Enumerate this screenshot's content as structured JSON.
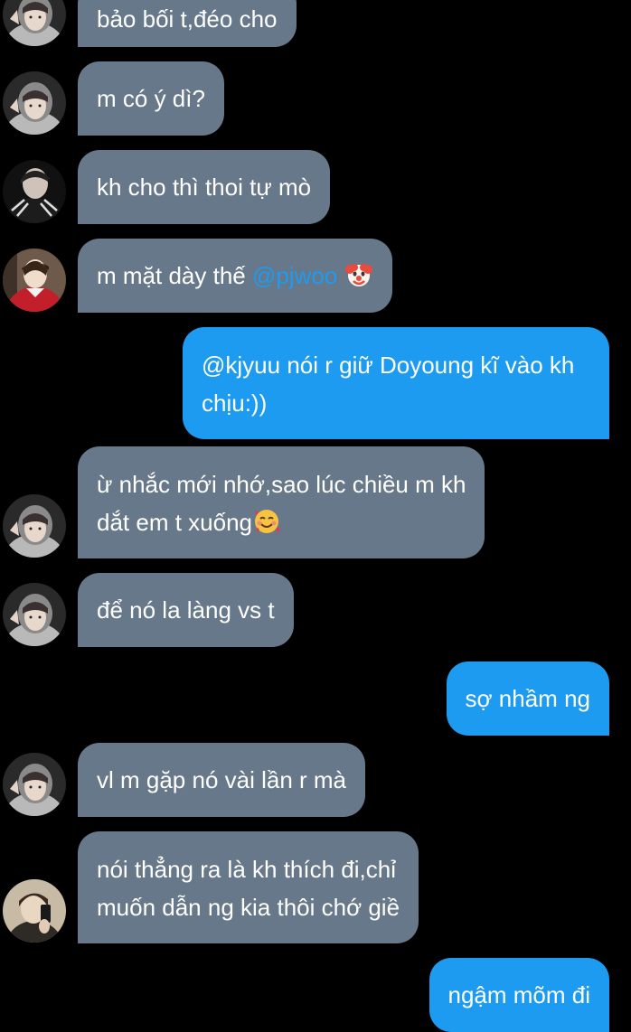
{
  "colors": {
    "background": "#000000",
    "incoming_bubble": "#67788a",
    "outgoing_bubble": "#1d9bf0",
    "mention": "#1d9bf0",
    "text": "#ffffff"
  },
  "messages": [
    {
      "direction": "incoming",
      "sender_avatar": "avatar-hood-boy-icon",
      "text": "bảo bối t,đéo cho"
    },
    {
      "direction": "incoming",
      "sender_avatar": "avatar-hood-boy-icon",
      "text": "m có ý dì?"
    },
    {
      "direction": "incoming",
      "sender_avatar": "avatar-dark-boy-icon",
      "text": "kh cho thì thoi tự mò"
    },
    {
      "direction": "incoming",
      "sender_avatar": "avatar-red-jacket-icon",
      "text_before": "m mặt dày thế ",
      "mention": "@pjwoo",
      "emoji": "clown-face-icon"
    },
    {
      "direction": "outgoing",
      "lines": [
        "@kjyuu nói r giữ Doyoung kĩ vào kh",
        "chịu:))"
      ]
    },
    {
      "direction": "incoming",
      "sender_avatar": "avatar-hood-boy-icon",
      "lines": [
        "ừ nhắc mới nhớ,sao lúc chiều m kh",
        "dắt em t xuống"
      ],
      "emoji": "smiling-face-with-hearts-icon"
    },
    {
      "direction": "incoming",
      "sender_avatar": "avatar-hood-boy-icon",
      "text": "để nó la làng vs t"
    },
    {
      "direction": "outgoing",
      "text": "sợ nhầm ng"
    },
    {
      "direction": "incoming",
      "sender_avatar": "avatar-hood-boy-icon",
      "text": "vl m gặp nó vài lần r mà"
    },
    {
      "direction": "incoming",
      "sender_avatar": "avatar-mirror-selfie-icon",
      "lines": [
        "nói thẳng ra là kh thích đi,chỉ",
        "muốn dẫn ng kia thôi chớ giề"
      ]
    },
    {
      "direction": "outgoing",
      "text": "ngậm mõm đi"
    }
  ]
}
